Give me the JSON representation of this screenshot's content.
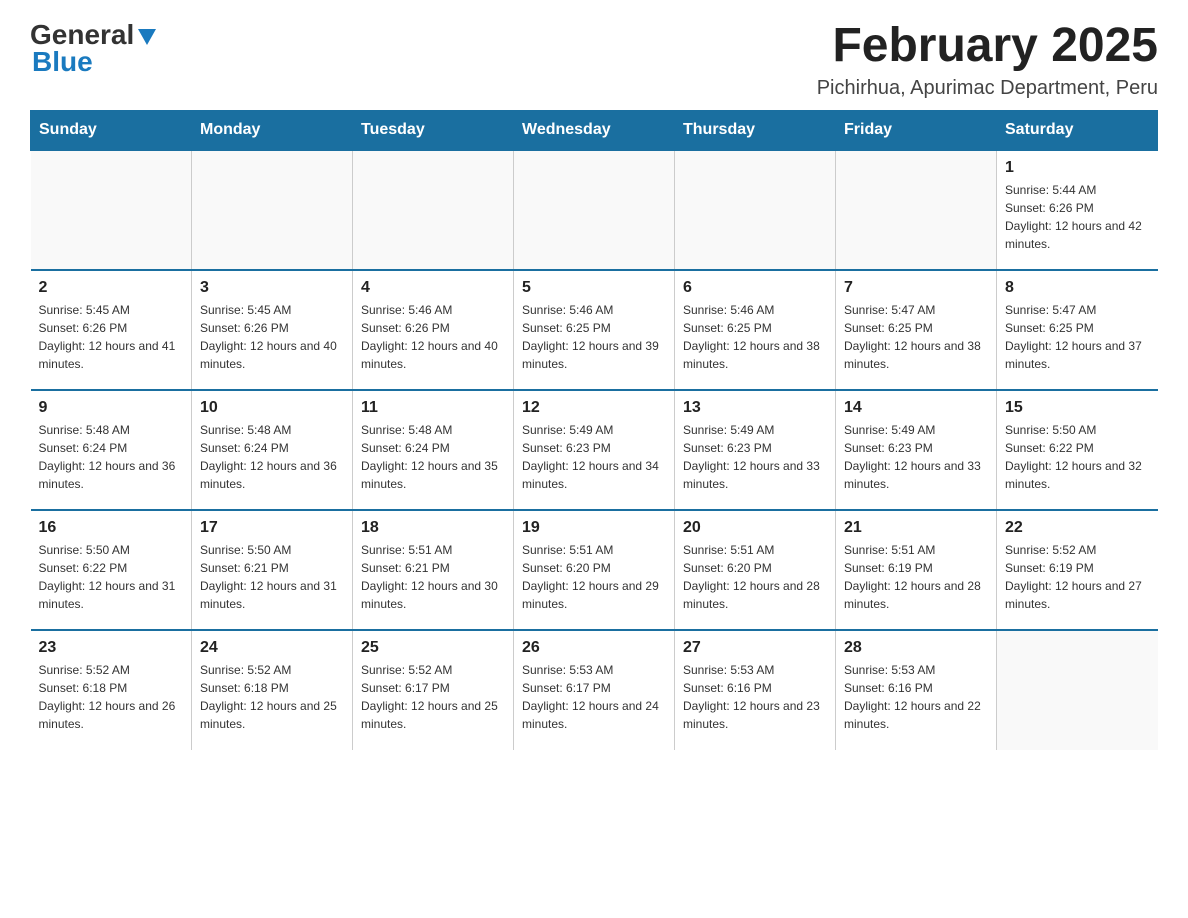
{
  "header": {
    "logo_general": "General",
    "logo_blue": "Blue",
    "month_title": "February 2025",
    "location": "Pichirhua, Apurimac Department, Peru"
  },
  "weekdays": [
    "Sunday",
    "Monday",
    "Tuesday",
    "Wednesday",
    "Thursday",
    "Friday",
    "Saturday"
  ],
  "weeks": [
    [
      {
        "day": "",
        "info": ""
      },
      {
        "day": "",
        "info": ""
      },
      {
        "day": "",
        "info": ""
      },
      {
        "day": "",
        "info": ""
      },
      {
        "day": "",
        "info": ""
      },
      {
        "day": "",
        "info": ""
      },
      {
        "day": "1",
        "info": "Sunrise: 5:44 AM\nSunset: 6:26 PM\nDaylight: 12 hours and 42 minutes."
      }
    ],
    [
      {
        "day": "2",
        "info": "Sunrise: 5:45 AM\nSunset: 6:26 PM\nDaylight: 12 hours and 41 minutes."
      },
      {
        "day": "3",
        "info": "Sunrise: 5:45 AM\nSunset: 6:26 PM\nDaylight: 12 hours and 40 minutes."
      },
      {
        "day": "4",
        "info": "Sunrise: 5:46 AM\nSunset: 6:26 PM\nDaylight: 12 hours and 40 minutes."
      },
      {
        "day": "5",
        "info": "Sunrise: 5:46 AM\nSunset: 6:25 PM\nDaylight: 12 hours and 39 minutes."
      },
      {
        "day": "6",
        "info": "Sunrise: 5:46 AM\nSunset: 6:25 PM\nDaylight: 12 hours and 38 minutes."
      },
      {
        "day": "7",
        "info": "Sunrise: 5:47 AM\nSunset: 6:25 PM\nDaylight: 12 hours and 38 minutes."
      },
      {
        "day": "8",
        "info": "Sunrise: 5:47 AM\nSunset: 6:25 PM\nDaylight: 12 hours and 37 minutes."
      }
    ],
    [
      {
        "day": "9",
        "info": "Sunrise: 5:48 AM\nSunset: 6:24 PM\nDaylight: 12 hours and 36 minutes."
      },
      {
        "day": "10",
        "info": "Sunrise: 5:48 AM\nSunset: 6:24 PM\nDaylight: 12 hours and 36 minutes."
      },
      {
        "day": "11",
        "info": "Sunrise: 5:48 AM\nSunset: 6:24 PM\nDaylight: 12 hours and 35 minutes."
      },
      {
        "day": "12",
        "info": "Sunrise: 5:49 AM\nSunset: 6:23 PM\nDaylight: 12 hours and 34 minutes."
      },
      {
        "day": "13",
        "info": "Sunrise: 5:49 AM\nSunset: 6:23 PM\nDaylight: 12 hours and 33 minutes."
      },
      {
        "day": "14",
        "info": "Sunrise: 5:49 AM\nSunset: 6:23 PM\nDaylight: 12 hours and 33 minutes."
      },
      {
        "day": "15",
        "info": "Sunrise: 5:50 AM\nSunset: 6:22 PM\nDaylight: 12 hours and 32 minutes."
      }
    ],
    [
      {
        "day": "16",
        "info": "Sunrise: 5:50 AM\nSunset: 6:22 PM\nDaylight: 12 hours and 31 minutes."
      },
      {
        "day": "17",
        "info": "Sunrise: 5:50 AM\nSunset: 6:21 PM\nDaylight: 12 hours and 31 minutes."
      },
      {
        "day": "18",
        "info": "Sunrise: 5:51 AM\nSunset: 6:21 PM\nDaylight: 12 hours and 30 minutes."
      },
      {
        "day": "19",
        "info": "Sunrise: 5:51 AM\nSunset: 6:20 PM\nDaylight: 12 hours and 29 minutes."
      },
      {
        "day": "20",
        "info": "Sunrise: 5:51 AM\nSunset: 6:20 PM\nDaylight: 12 hours and 28 minutes."
      },
      {
        "day": "21",
        "info": "Sunrise: 5:51 AM\nSunset: 6:19 PM\nDaylight: 12 hours and 28 minutes."
      },
      {
        "day": "22",
        "info": "Sunrise: 5:52 AM\nSunset: 6:19 PM\nDaylight: 12 hours and 27 minutes."
      }
    ],
    [
      {
        "day": "23",
        "info": "Sunrise: 5:52 AM\nSunset: 6:18 PM\nDaylight: 12 hours and 26 minutes."
      },
      {
        "day": "24",
        "info": "Sunrise: 5:52 AM\nSunset: 6:18 PM\nDaylight: 12 hours and 25 minutes."
      },
      {
        "day": "25",
        "info": "Sunrise: 5:52 AM\nSunset: 6:17 PM\nDaylight: 12 hours and 25 minutes."
      },
      {
        "day": "26",
        "info": "Sunrise: 5:53 AM\nSunset: 6:17 PM\nDaylight: 12 hours and 24 minutes."
      },
      {
        "day": "27",
        "info": "Sunrise: 5:53 AM\nSunset: 6:16 PM\nDaylight: 12 hours and 23 minutes."
      },
      {
        "day": "28",
        "info": "Sunrise: 5:53 AM\nSunset: 6:16 PM\nDaylight: 12 hours and 22 minutes."
      },
      {
        "day": "",
        "info": ""
      }
    ]
  ]
}
